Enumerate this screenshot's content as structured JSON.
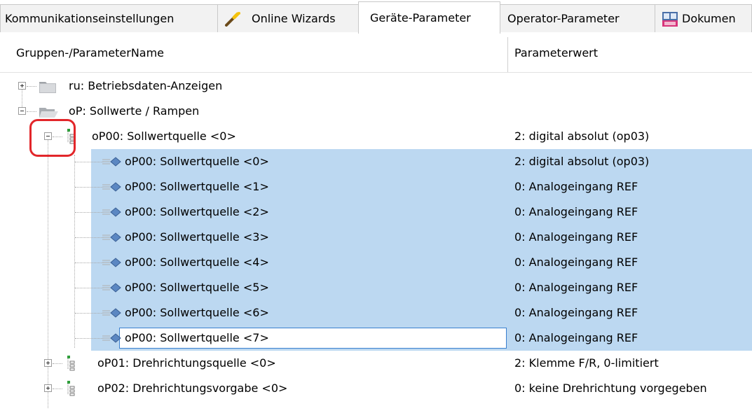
{
  "tabs": [
    {
      "label": "Kommunikationseinstellungen",
      "icon": null,
      "active": false
    },
    {
      "label": "Online Wizards",
      "icon": "wand-icon",
      "active": false
    },
    {
      "label": "Geräte-Parameter",
      "icon": null,
      "active": true
    },
    {
      "label": "Operator-Parameter",
      "icon": null,
      "active": false
    },
    {
      "label": "Dokumen",
      "icon": "keb-document-icon",
      "active": false
    }
  ],
  "columns": {
    "name_header": "Gruppen-/ParameterName",
    "value_header": "Parameterwert"
  },
  "tree": {
    "group_ru": {
      "name": "ru: Betriebsdaten-Anzeigen",
      "expanded": false
    },
    "group_op": {
      "name": "oP: Sollwerte / Rampen",
      "expanded": true
    },
    "op00": {
      "name": "oP00: Sollwertquelle <0>",
      "value": "2: digital absolut (op03)",
      "expanded": true
    },
    "op00_sets": [
      {
        "name": "oP00: Sollwertquelle <0>",
        "value": "2: digital absolut (op03)"
      },
      {
        "name": "oP00: Sollwertquelle <1>",
        "value": "0: Analogeingang REF"
      },
      {
        "name": "oP00: Sollwertquelle <2>",
        "value": "0: Analogeingang REF"
      },
      {
        "name": "oP00: Sollwertquelle <3>",
        "value": "0: Analogeingang REF"
      },
      {
        "name": "oP00: Sollwertquelle <4>",
        "value": "0: Analogeingang REF"
      },
      {
        "name": "oP00: Sollwertquelle <5>",
        "value": "0: Analogeingang REF"
      },
      {
        "name": "oP00: Sollwertquelle <6>",
        "value": "0: Analogeingang REF"
      },
      {
        "name": "oP00: Sollwertquelle <7>",
        "value": "0: Analogeingang REF"
      }
    ],
    "op01": {
      "name": "oP01: Drehrichtungsquelle <0>",
      "value": "2: Klemme F/R, 0-limitiert",
      "expanded": false
    },
    "op02": {
      "name": "oP02: Drehrichtungsvorgabe <0>",
      "value": "0: keine Drehrichtung vorgegeben",
      "expanded": false
    }
  },
  "colors": {
    "selection": "#bcd8f1",
    "focus_border": "#3a7fcf",
    "highlight_annotation": "#e2262a"
  }
}
